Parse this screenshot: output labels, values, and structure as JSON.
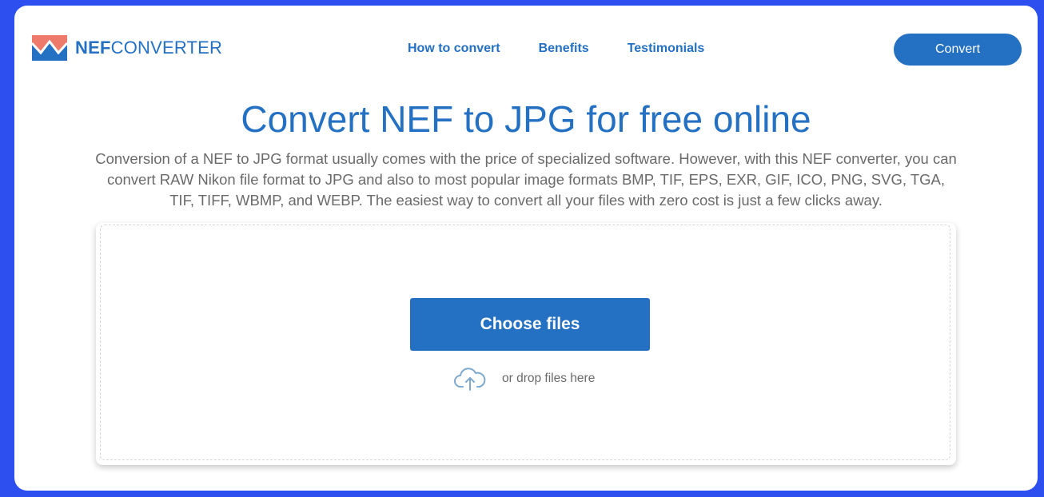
{
  "header": {
    "logo": {
      "bold": "NEF",
      "regular": "CONVERTER"
    },
    "nav": [
      {
        "label": "How to convert"
      },
      {
        "label": "Benefits"
      },
      {
        "label": "Testimonials"
      }
    ],
    "convert_button": "Convert"
  },
  "hero": {
    "title": "Convert NEF to JPG for free online",
    "description": "Conversion of a NEF to JPG format usually comes with the price of specialized software. However, with this NEF converter, you can convert RAW Nikon file format to JPG and also to most popular image formats BMP, TIF, EPS, EXR, GIF, ICO, PNG, SVG, TGA, TIF, TIFF, WBMP, and WEBP. The easiest way to convert all your files with zero cost is just a few clicks away."
  },
  "upload": {
    "choose_label": "Choose files",
    "drop_text": "or drop files here",
    "icon": "cloud-upload-icon"
  },
  "colors": {
    "brand": "#2470c3",
    "frame": "#2d4ff0",
    "logo_accent": "#ee7a6c",
    "icon_light": "#7fa8cf"
  }
}
